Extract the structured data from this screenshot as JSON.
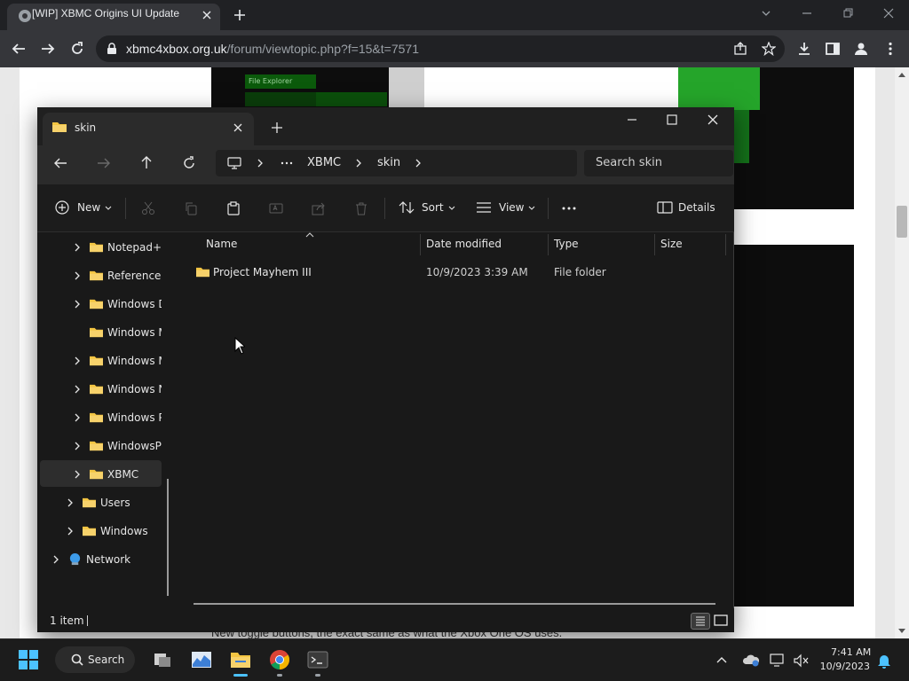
{
  "browser": {
    "tab_title": "[WIP] XBMC Origins UI Update",
    "url_domain": "xbmc4xbox.org.uk",
    "url_path": "/forum/viewtopic.php?f=15&t=7571"
  },
  "webpage": {
    "image_label": "File Explorer",
    "caption": "New toggle buttons, the exact same as what the Xbox One OS uses."
  },
  "explorer": {
    "tab_title": "skin",
    "breadcrumb": [
      "XBMC",
      "skin"
    ],
    "search_placeholder": "Search skin",
    "toolbar": {
      "new_label": "New",
      "sort_label": "Sort",
      "view_label": "View",
      "details_label": "Details"
    },
    "nav_tree": [
      {
        "label": "Notepad++",
        "expandable": true
      },
      {
        "label": "Reference Assemblies",
        "expandable": true
      },
      {
        "label": "Windows Defender",
        "expandable": true
      },
      {
        "label": "Windows Mail",
        "expandable": false
      },
      {
        "label": "Windows Media Player",
        "expandable": true
      },
      {
        "label": "Windows NT",
        "expandable": true
      },
      {
        "label": "Windows Photo Viewer",
        "expandable": true
      },
      {
        "label": "WindowsPowerShell",
        "expandable": true
      },
      {
        "label": "XBMC",
        "expandable": true,
        "selected": true
      },
      {
        "label": "Users",
        "expandable": true
      },
      {
        "label": "Windows",
        "expandable": true
      },
      {
        "label": "Network",
        "expandable": true
      }
    ],
    "columns": [
      "Name",
      "Date modified",
      "Type",
      "Size"
    ],
    "files": [
      {
        "name": "Project Mayhem III",
        "date": "10/9/2023 3:39 AM",
        "type": "File folder",
        "size": ""
      }
    ],
    "status": "1 item"
  },
  "taskbar": {
    "search_label": "Search",
    "time": "7:41 AM",
    "date": "10/9/2023"
  },
  "colors": {
    "folder": "#f4c542",
    "accent": "#0a84ff",
    "dark_bg": "#191919"
  }
}
